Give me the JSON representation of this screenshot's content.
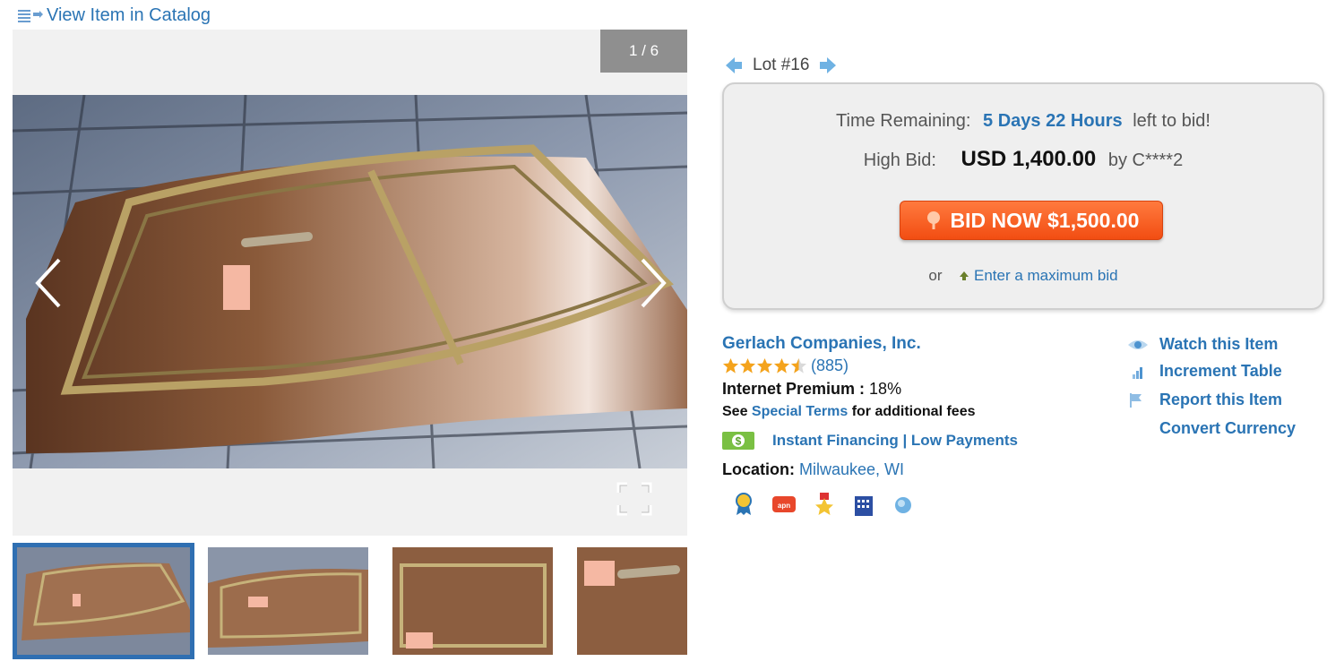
{
  "catalog_link": {
    "label": "View Item in Catalog"
  },
  "viewer": {
    "counter": "1 / 6"
  },
  "lot": {
    "label": "Lot #16"
  },
  "bid_box": {
    "time_label": "Time Remaining:",
    "time_value": "5 Days 22 Hours",
    "time_suffix": "left to bid!",
    "high_bid_label": "High Bid:",
    "high_bid_amount": "USD 1,400.00",
    "high_bidder": "by C****2",
    "bid_button_label": "BID NOW $1,500.00",
    "or_text": "or",
    "max_bid_link": "Enter a maximum bid"
  },
  "seller": {
    "name": "Gerlach Companies, Inc.",
    "rating_stars": 4.5,
    "review_count": "(885)",
    "premium_label": "Internet Premium :",
    "premium_value": "18%",
    "special_prefix": "See",
    "special_link": "Special Terms",
    "special_suffix": "for additional fees",
    "financing_link": "Instant Financing | Low Payments",
    "location_label": "Location:",
    "location_value": "Milwaukee, WI"
  },
  "side_links": {
    "watch": "Watch this Item",
    "increment": "Increment Table",
    "report": "Report this Item",
    "convert": "Convert Currency"
  },
  "colors": {
    "link_blue": "#2a74b4",
    "bid_orange": "#f24d12",
    "thumb_border": "#2f6fb2"
  }
}
